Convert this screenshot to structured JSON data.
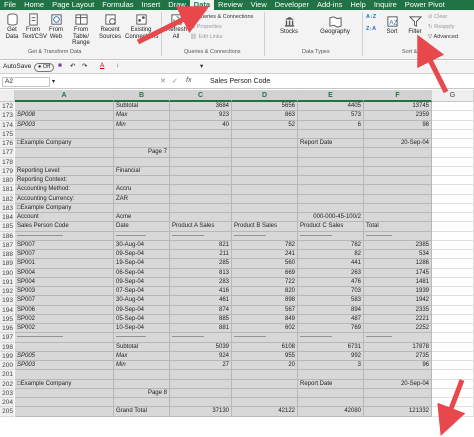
{
  "ribbon_tabs": [
    "File",
    "Home",
    "Page Layout",
    "Formulas",
    "Insert",
    "Draw",
    "Data",
    "Review",
    "View",
    "Developer",
    "Add-ins",
    "Help",
    "Inquire",
    "Power Pivot"
  ],
  "get_transform": {
    "get_data": "Get Data",
    "from_text_csv": "From Text/CSV",
    "from_web": "From Web",
    "from_table_range": "From Table/ Range",
    "recent_sources": "Recent Sources",
    "existing_connections": "Existing Connections",
    "group_label": "Get & Transform Data"
  },
  "queries": {
    "refresh_all": "Refresh All",
    "queries_connections": "Queries & Connections",
    "properties": "Properties",
    "edit_links": "Edit Links",
    "group_label": "Queries & Connections"
  },
  "data_types": {
    "stocks": "Stocks",
    "geography": "Geography",
    "group_label": "Data Types"
  },
  "sort_filter": {
    "sort_az": "A↓Z",
    "sort_za": "Z↓A",
    "sort": "Sort",
    "filter": "Filter",
    "clear": "Clear",
    "reapply": "Reapply",
    "advanced": "Advanced",
    "group_label": "Sort & Filter"
  },
  "quick_access": {
    "autosave": "AutoSave",
    "toggle": "Off"
  },
  "formula_bar": {
    "name_box": "A2",
    "fx": "fx",
    "content": "Sales Person Code"
  },
  "columns": [
    "A",
    "B",
    "C",
    "D",
    "E",
    "F",
    "G"
  ],
  "rows": [
    {
      "n": "172",
      "c": [
        "",
        "Subtotal",
        "3684",
        "5656",
        "4405",
        "13745"
      ]
    },
    {
      "n": "173",
      "c": [
        "SP008",
        "Max",
        "923",
        "863",
        "573",
        "2359"
      ]
    },
    {
      "n": "174",
      "c": [
        "SP003",
        "Min",
        "40",
        "52",
        "6",
        "98"
      ]
    },
    {
      "n": "175",
      "c": [
        "",
        "",
        "",
        "",
        "",
        ""
      ]
    },
    {
      "n": "176",
      "c": [
        "□Example Company",
        "",
        "",
        "",
        "Report Date",
        "20-Sep-04"
      ]
    },
    {
      "n": "177",
      "c": [
        "",
        "Page 7",
        "",
        "",
        "",
        ""
      ]
    },
    {
      "n": "178",
      "c": [
        "",
        "",
        "",
        "",
        "",
        ""
      ]
    },
    {
      "n": "179",
      "c": [
        "Reporting Level:",
        "Financial",
        "",
        "",
        "",
        ""
      ]
    },
    {
      "n": "180",
      "c": [
        "Reporting Context:",
        "",
        "",
        "",
        "",
        ""
      ]
    },
    {
      "n": "181",
      "c": [
        "Accounting Method:",
        "Accru",
        "",
        "",
        "",
        ""
      ]
    },
    {
      "n": "182",
      "c": [
        "Accounting Currency:",
        "ZAR",
        "",
        "",
        "",
        ""
      ]
    },
    {
      "n": "183",
      "c": [
        "□Example Company",
        "",
        "",
        "",
        "",
        ""
      ]
    },
    {
      "n": "184",
      "c": [
        "Account",
        "Acme",
        "",
        "",
        "000-000-45-100/2",
        ""
      ]
    },
    {
      "n": "185",
      "c": [
        "Sales Person Code",
        "Date",
        "Product A Sales",
        "Product B Sales",
        "Product C Sales",
        "Total"
      ]
    },
    {
      "n": "186",
      "c": [
        "-----------------------",
        "---------------",
        "----------------",
        "----------------",
        "----------------",
        "-------------"
      ]
    },
    {
      "n": "187",
      "c": [
        "SP007",
        "30-Aug-04",
        "821",
        "782",
        "782",
        "2385"
      ]
    },
    {
      "n": "188",
      "c": [
        "SP007",
        "09-Sep-04",
        "211",
        "241",
        "82",
        "534"
      ]
    },
    {
      "n": "189",
      "c": [
        "SP001",
        "19-Sep-04",
        "285",
        "560",
        "441",
        "1286"
      ]
    },
    {
      "n": "190",
      "c": [
        "SP004",
        "06-Sep-04",
        "813",
        "669",
        "263",
        "1745"
      ]
    },
    {
      "n": "191",
      "c": [
        "SP004",
        "09-Sep-04",
        "283",
        "722",
        "476",
        "1481"
      ]
    },
    {
      "n": "192",
      "c": [
        "SP003",
        "07-Sep-04",
        "416",
        "820",
        "703",
        "1939"
      ]
    },
    {
      "n": "193",
      "c": [
        "SP007",
        "30-Aug-04",
        "461",
        "898",
        "583",
        "1942"
      ]
    },
    {
      "n": "194",
      "c": [
        "SP006",
        "09-Sep-04",
        "874",
        "567",
        "894",
        "2335"
      ]
    },
    {
      "n": "195",
      "c": [
        "SP002",
        "05-Sep-04",
        "885",
        "849",
        "487",
        "2221"
      ]
    },
    {
      "n": "196",
      "c": [
        "SP002",
        "10-Sep-04",
        "881",
        "602",
        "769",
        "2252"
      ]
    },
    {
      "n": "197",
      "c": [
        "-----------------------",
        "---------------",
        "----------------",
        "----------------",
        "----------------",
        "-------------"
      ]
    },
    {
      "n": "198",
      "c": [
        "",
        "Subtotal",
        "5039",
        "6108",
        "6731",
        "17878"
      ]
    },
    {
      "n": "199",
      "c": [
        "SP005",
        "Max",
        "924",
        "955",
        "992",
        "2735"
      ]
    },
    {
      "n": "200",
      "c": [
        "SP003",
        "Min",
        "27",
        "20",
        "3",
        "96"
      ]
    },
    {
      "n": "201",
      "c": [
        "",
        "",
        "",
        "",
        "",
        ""
      ]
    },
    {
      "n": "202",
      "c": [
        "□Example Company",
        "",
        "",
        "",
        "Report Date",
        "20-Sep-04"
      ]
    },
    {
      "n": "203",
      "c": [
        "",
        "Page 8",
        "",
        "",
        "",
        ""
      ]
    },
    {
      "n": "204",
      "c": [
        "",
        "",
        "",
        "",
        "",
        ""
      ]
    },
    {
      "n": "205",
      "c": [
        "",
        "Grand Total",
        "37130",
        "42122",
        "42080",
        "121332"
      ]
    }
  ],
  "colors": {
    "excel_green": "#217346",
    "arrow_red": "#e8474c",
    "selection_gray": "#d8d8d8"
  }
}
